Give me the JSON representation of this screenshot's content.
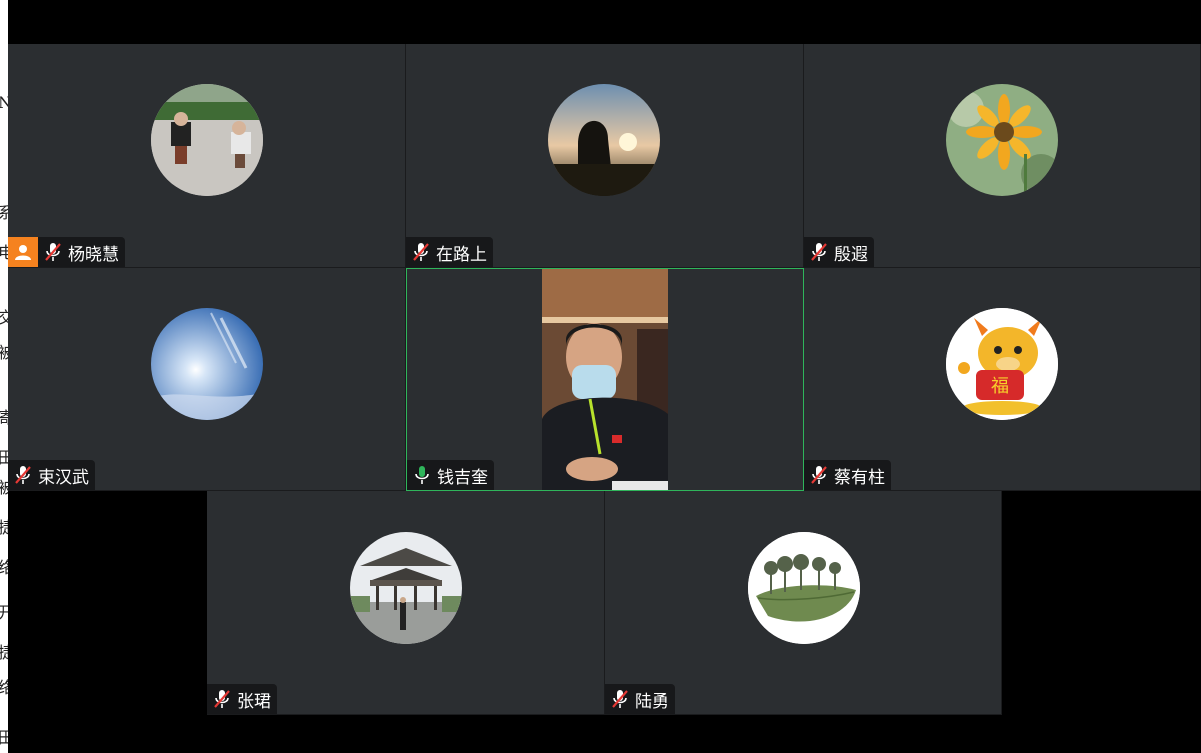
{
  "participants": [
    {
      "name": "杨晓慧",
      "mic": "muted",
      "host": true,
      "avatar": "two-people-photo"
    },
    {
      "name": "在路上",
      "mic": "muted",
      "host": false,
      "avatar": "silhouette-sunset-photo"
    },
    {
      "name": "殷遐",
      "mic": "muted",
      "host": false,
      "avatar": "sunflower-photo"
    },
    {
      "name": "束汉武",
      "mic": "muted",
      "host": false,
      "avatar": "blue-sky-sun-photo"
    },
    {
      "name": "钱吉奎",
      "mic": "active",
      "host": false,
      "avatar": "live-video",
      "active_speaker": true
    },
    {
      "name": "蔡有柱",
      "mic": "muted",
      "host": false,
      "avatar": "lucky-ox-cartoon"
    },
    {
      "name": "张珺",
      "mic": "muted",
      "host": false,
      "avatar": "pavilion-photo"
    },
    {
      "name": "陆勇",
      "mic": "muted",
      "host": false,
      "avatar": "leaf-trees-art"
    }
  ],
  "colors": {
    "tile_bg": "#2b2e31",
    "host_badge": "#f5821f",
    "active_border": "#2fb55b",
    "muted_mic": "#e53935",
    "active_mic": "#2fb55b"
  },
  "icons": [
    "user-host-icon",
    "mic-muted-icon",
    "mic-active-icon"
  ]
}
